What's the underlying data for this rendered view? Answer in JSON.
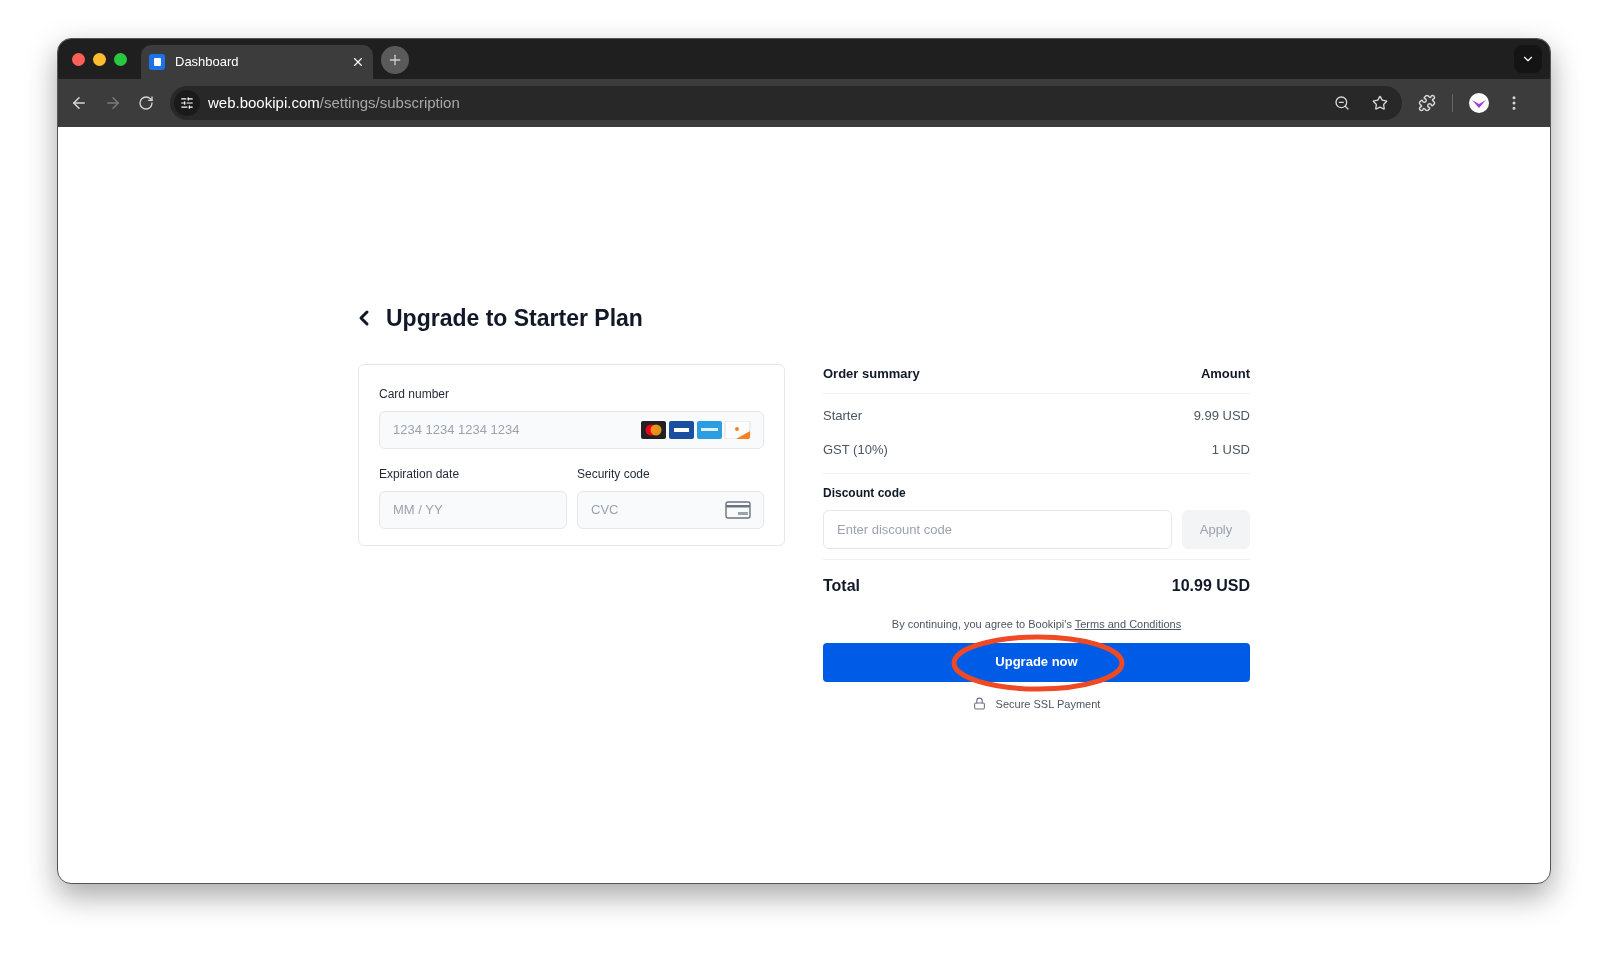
{
  "browser": {
    "tab": {
      "title": "Dashboard"
    },
    "url": {
      "host": "web.bookipi.com",
      "path": "/settings/subscription"
    }
  },
  "page": {
    "title": "Upgrade to Starter Plan",
    "card_form": {
      "card_number": {
        "label": "Card number",
        "placeholder": "1234 1234 1234 1234"
      },
      "expiration": {
        "label": "Expiration date",
        "placeholder": "MM / YY"
      },
      "security": {
        "label": "Security code",
        "placeholder": "CVC"
      }
    },
    "order_summary": {
      "heading": "Order summary",
      "amount_heading": "Amount",
      "lines": [
        {
          "name": "Starter",
          "amount": "9.99 USD"
        },
        {
          "name": "GST (10%)",
          "amount": "1 USD"
        }
      ],
      "discount": {
        "label": "Discount code",
        "placeholder": "Enter discount code",
        "apply": {
          "label": "Apply",
          "disabled": true
        }
      },
      "total": {
        "label": "Total",
        "amount": "10.99 USD"
      },
      "agreement": {
        "text": "By continuing, you agree to Bookipi's",
        "link": "Terms and Conditions"
      },
      "upgrade_button": "Upgrade now",
      "secure_note": "Secure SSL Payment"
    }
  }
}
